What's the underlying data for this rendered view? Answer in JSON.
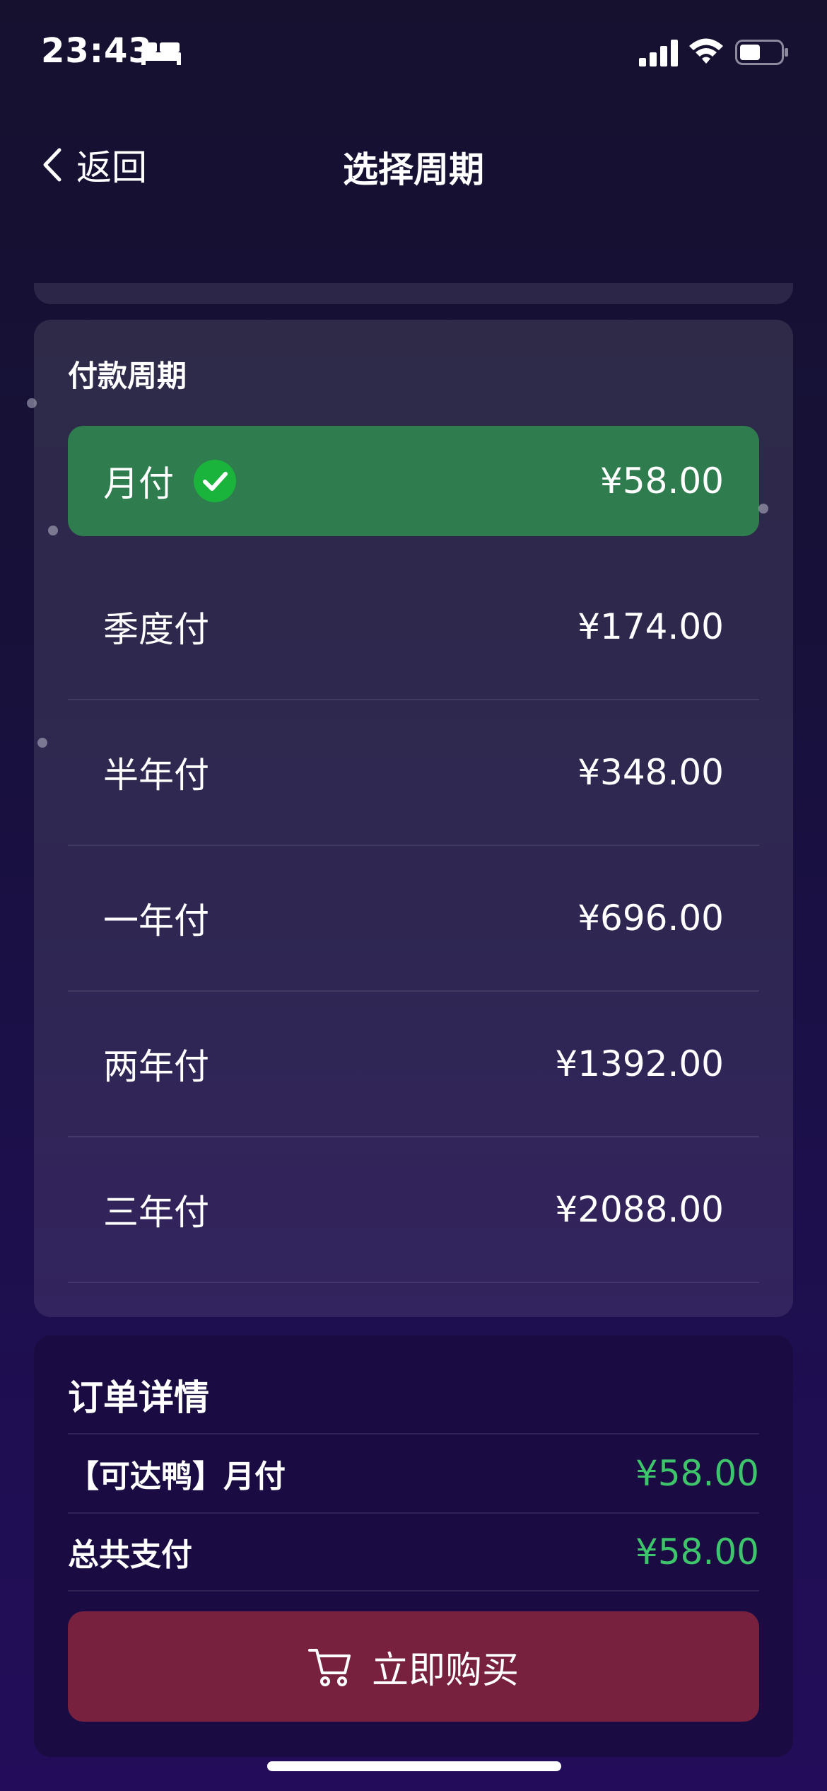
{
  "status_bar": {
    "time": "23:43",
    "icons": [
      "bed-icon",
      "signal-icon",
      "wifi-icon",
      "battery-icon"
    ]
  },
  "nav": {
    "back_label": "返回",
    "title": "选择周期"
  },
  "payment_period": {
    "heading": "付款周期",
    "options": [
      {
        "label": "月付",
        "price": "¥58.00",
        "selected": true
      },
      {
        "label": "季度付",
        "price": "¥174.00"
      },
      {
        "label": "半年付",
        "price": "¥348.00"
      },
      {
        "label": "一年付",
        "price": "¥696.00"
      },
      {
        "label": "两年付",
        "price": "¥1392.00"
      },
      {
        "label": "三年付",
        "price": "¥2088.00"
      }
    ]
  },
  "order": {
    "heading": "订单详情",
    "item_label": "【可达鸭】月付",
    "item_price": "¥58.00",
    "total_label": "总共支付",
    "total_price": "¥58.00",
    "buy_label": "立即购买"
  },
  "colors": {
    "selected_option": "#2f7c4f",
    "price_green": "#3ec56c",
    "buy_button": "#77213f",
    "check_green": "#1ab33c"
  }
}
